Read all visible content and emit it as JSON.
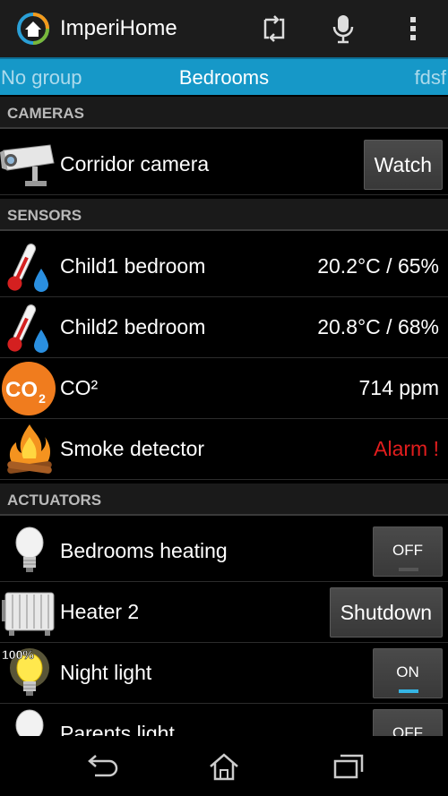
{
  "app": {
    "title": "ImperiHome"
  },
  "tabs": {
    "left": "No group",
    "center": "Bedrooms",
    "right": "fdsf"
  },
  "sections": {
    "cameras": "CAMERAS",
    "sensors": "SENSORS",
    "actuators": "ACTUATORS"
  },
  "cameras": [
    {
      "label": "Corridor camera",
      "button": "Watch",
      "icon": "security-camera-icon"
    }
  ],
  "sensors": [
    {
      "label": "Child1 bedroom",
      "value": "20.2°C / 65%",
      "icon": "thermometer-humidity-icon"
    },
    {
      "label": "Child2 bedroom",
      "value": "20.8°C / 68%",
      "icon": "thermometer-humidity-icon"
    },
    {
      "label": "CO²",
      "value": "714 ppm",
      "icon": "co2-icon",
      "icon_text": "CO",
      "icon_sub": "2"
    },
    {
      "label": "Smoke detector",
      "value": "Alarm !",
      "icon": "fire-icon"
    }
  ],
  "actuators": [
    {
      "label": "Bedrooms heating",
      "state": "OFF",
      "icon": "light-bulb-off-icon"
    },
    {
      "label": "Heater 2",
      "button": "Shutdown",
      "icon": "radiator-icon"
    },
    {
      "label": "Night light",
      "state": "ON",
      "level": "100%",
      "icon": "light-bulb-on-icon"
    },
    {
      "label": "Parents light",
      "state": "OFF",
      "icon": "light-bulb-off-icon"
    }
  ],
  "colors": {
    "accent": "#1698c8",
    "alarm": "#e21d1d",
    "toggle_on": "#35b5e5"
  }
}
